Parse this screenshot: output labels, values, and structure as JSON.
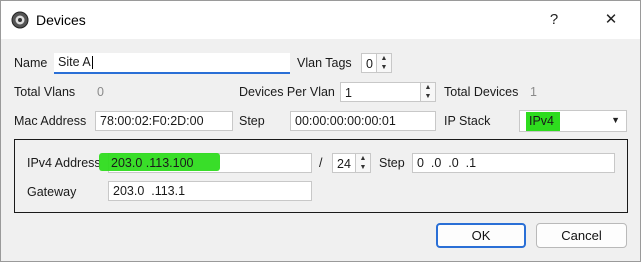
{
  "window": {
    "title": "Devices",
    "help_label": "?",
    "close_label": "✕"
  },
  "row1": {
    "name_label": "Name",
    "name_value": "Site A",
    "vlan_tags_label": "Vlan Tags",
    "vlan_tags_value": "0"
  },
  "row2": {
    "total_vlans_label": "Total Vlans",
    "total_vlans_value": "0",
    "devices_per_vlan_label": "Devices Per Vlan",
    "devices_per_vlan_value": "1",
    "total_devices_label": "Total Devices",
    "total_devices_value": "1"
  },
  "row3": {
    "mac_label": "Mac Address",
    "mac_value": "78:00:02:F0:2D:00",
    "step_label": "Step",
    "step_value": "00:00:00:00:00:01",
    "ip_stack_label": "IP Stack",
    "ip_stack_value": "IPv4"
  },
  "ipv4": {
    "address_label": "IPv4 Address",
    "address_value": "203.0  .113.100",
    "slash": "/",
    "prefix_value": "24",
    "step_label": "Step",
    "step_value": "0  .0  .0  .1",
    "gateway_label": "Gateway",
    "gateway_value": "203.0  .113.1"
  },
  "buttons": {
    "ok_label": "OK",
    "cancel_label": "Cancel"
  },
  "colors": {
    "highlight": "#2edc1e",
    "accent": "#2a6fd6"
  }
}
